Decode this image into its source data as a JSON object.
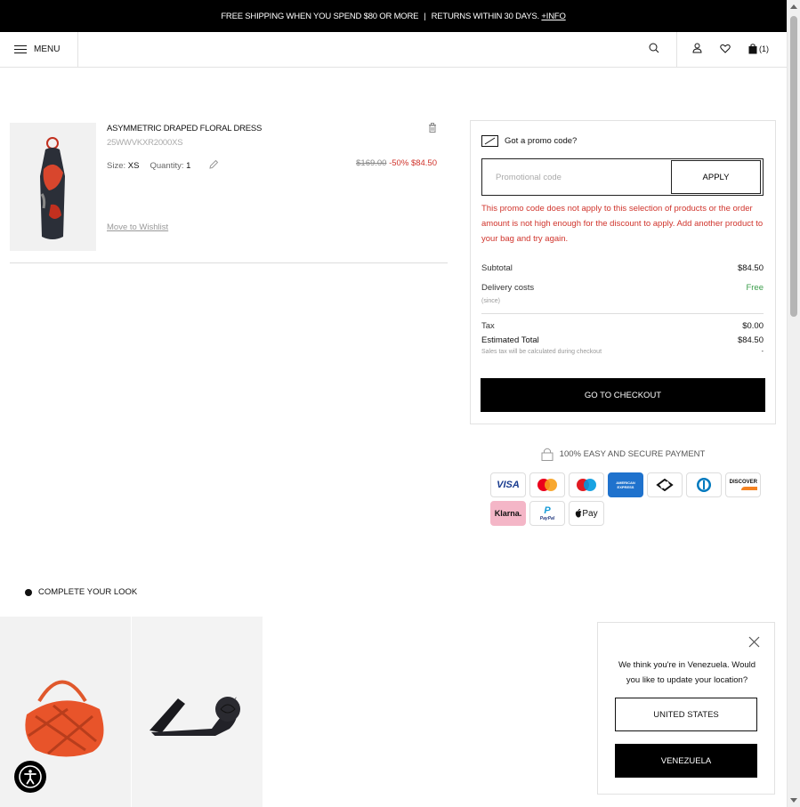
{
  "topbar": {
    "text": "FREE SHIPPING WHEN YOU SPEND $80 OR MORE",
    "separator": "|",
    "returns": "RETURNS WITHIN 30 DAYS.",
    "more": "+INFO"
  },
  "header": {
    "menu_label": "MENU",
    "cart_count": "(1)"
  },
  "cart_item": {
    "name": "ASYMMETRIC DRAPED FLORAL DRESS",
    "sku": "25WWVKXR2000XS",
    "size_label": "Size:",
    "size_value": "XS",
    "quantity_label": "Quantity:",
    "quantity_value": "1",
    "original_price": "$169.00",
    "discount": "-50%",
    "price": "$84.50",
    "wishlist_link": "Move to Wishlist"
  },
  "summary": {
    "promo_title": "Got a promo code?",
    "promo_placeholder": "Promotional code",
    "apply_label": "APPLY",
    "promo_error": "This promo code does not apply to this selection of products or the order amount is not high enough for the discount to apply. Add another product to your bag and try again.",
    "subtotal_label": "Subtotal",
    "subtotal_value": "$84.50",
    "delivery_label": "Delivery costs",
    "delivery_value": "Free",
    "delivery_note": "(since)",
    "tax_label": "Tax",
    "tax_value": "$0.00",
    "total_label": "Estimated Total",
    "total_value": "$84.50",
    "tax_note": "Sales tax will be calculated during checkout",
    "tax_note_value": "-",
    "checkout_label": "GO TO CHECKOUT"
  },
  "payment": {
    "secure_label": "100% EASY AND  SECURE PAYMENT",
    "methods": [
      "VISA",
      "Mastercard",
      "Maestro",
      "AMERICAN EXPRESS",
      "Afterpay",
      "Diners Club",
      "DISCOVER",
      "Klarna.",
      "PayPal",
      "Apple Pay"
    ],
    "visa": "VISA",
    "amex": "AMERICAN EXPRESS",
    "discover": "DISCOVER",
    "klarna": "Klarna.",
    "paypal_p": "P",
    "paypal": "PayPal",
    "applepay": "Pay"
  },
  "look": {
    "title": "COMPLETE YOUR LOOK"
  },
  "location_popup": {
    "message": "We think you're in Venezuela. Would you like to update your location?",
    "option_us": "UNITED STATES",
    "option_ve": "VENEZUELA"
  },
  "colors": {
    "accent_red": "#d0342c",
    "free_green": "#3a9d4a",
    "black": "#000000"
  }
}
